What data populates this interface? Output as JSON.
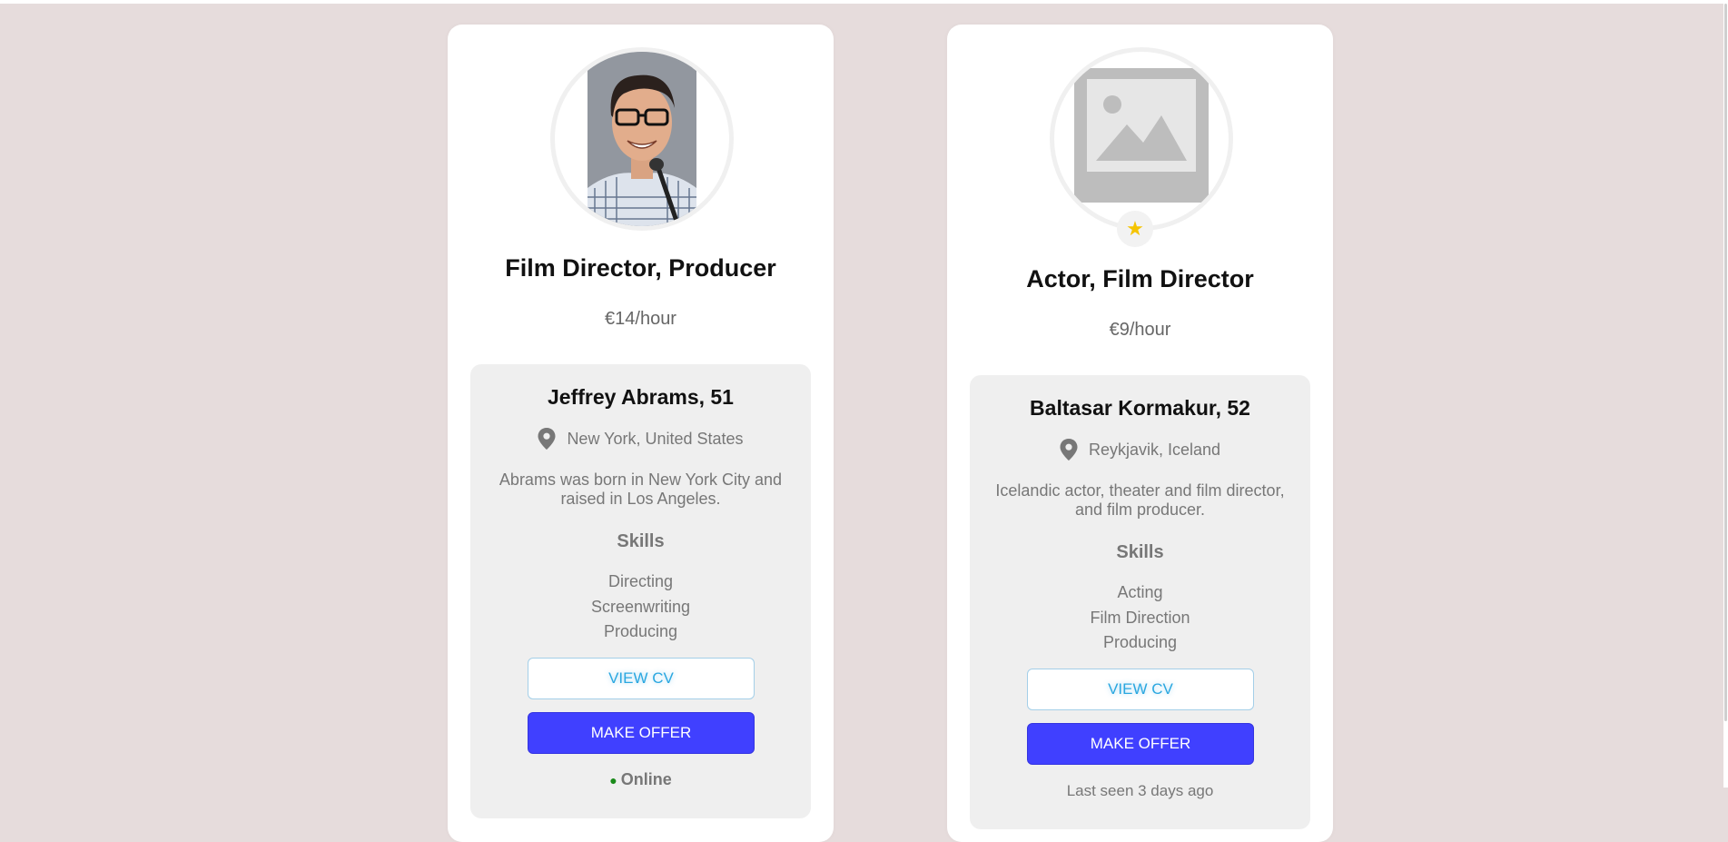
{
  "profiles": [
    {
      "photo": "person-photo",
      "title": "Film Director, Producer",
      "rate": "€14/hour",
      "name": "Jeffrey Abrams, 51",
      "location": "New York, United States",
      "bio": "Abrams was born in New York City and raised in Los Angeles.",
      "skills_heading": "Skills",
      "skills": [
        "Directing",
        "Screenwriting",
        "Producing"
      ],
      "view_cv_label": "VIEW CV",
      "make_offer_label": "MAKE OFFER",
      "status": "Online",
      "featured": false
    },
    {
      "photo": "image-placeholder-icon",
      "title": "Actor, Film Director",
      "rate": "€9/hour",
      "name": "Baltasar Kormakur, 52",
      "location": "Reykjavik, Iceland",
      "bio": "Icelandic actor, theater and film director, and film producer.",
      "skills_heading": "Skills",
      "skills": [
        "Acting",
        "Film Direction",
        "Producing"
      ],
      "view_cv_label": "VIEW CV",
      "make_offer_label": "MAKE OFFER",
      "status": "Last seen 3 days ago",
      "featured": true,
      "badge_icon": "star-icon"
    }
  ],
  "colors": {
    "page_background": "#e6dcdc",
    "card_background": "#ffffff",
    "panel_background": "#efefef",
    "primary_button": "#4040ff",
    "link_blue": "#2aa7e0",
    "online_green": "#1a8a1a",
    "star_yellow": "#f5c400"
  }
}
